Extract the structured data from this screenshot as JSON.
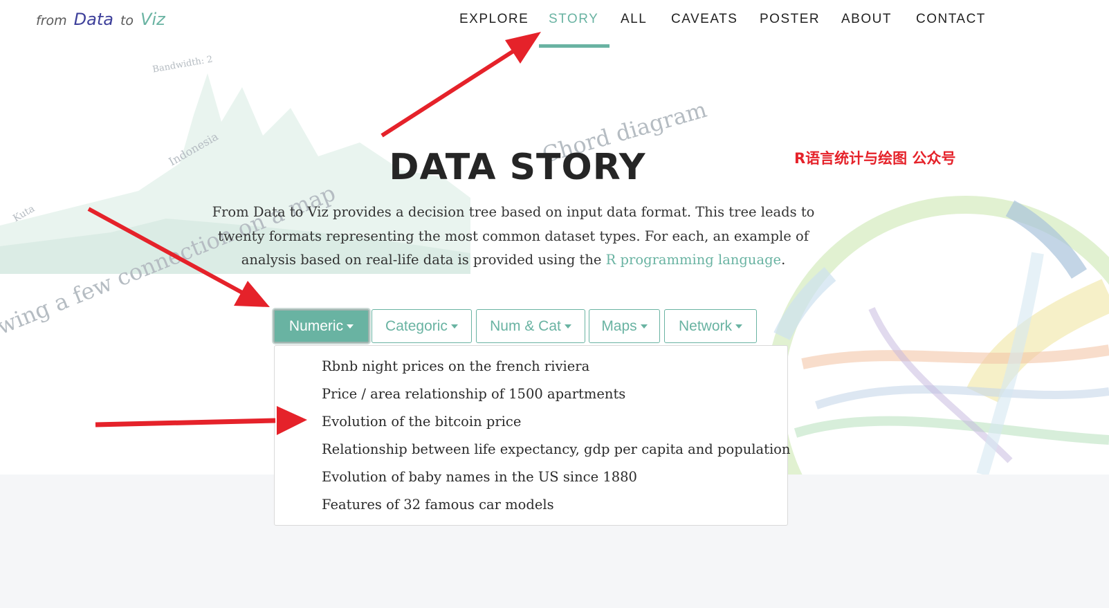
{
  "logo": {
    "part1": "from",
    "part2": "Data",
    "part3": "to",
    "part4": "Viz"
  },
  "nav": {
    "items": [
      "EXPLORE",
      "STORY",
      "ALL",
      "CAVEATS",
      "POSTER",
      "ABOUT",
      "CONTACT"
    ],
    "active": "STORY"
  },
  "hero": {
    "title": "DATA STORY",
    "intro_before_link": "From Data to Viz provides a decision tree based on input data format. This tree leads to twenty formats representing the most common dataset types. For each, an example of analysis based on real-life data is provided using the ",
    "intro_link": "R programming language",
    "intro_after_link": "."
  },
  "watermark": "R语言统计与绘图 公众号",
  "buttons": [
    "Numeric",
    "Categoric",
    "Num & Cat",
    "Maps",
    "Network"
  ],
  "active_button": "Numeric",
  "dropdown": {
    "items": [
      "Rbnb night prices on the french riviera",
      "Price / area relationship of 1500 apartments",
      "Evolution of the bitcoin price",
      "Relationship between life expectancy, gdp per capita and population",
      "Evolution of baby names in the US since 1880",
      "Features of 32 famous car models"
    ]
  },
  "background_text": {
    "chord": "Chord diagram",
    "connection": "wing a few connection on a map",
    "indonesia": "Indonesia",
    "bandwidth": "Bandwidth: 2",
    "kuta": "Kuta"
  },
  "colors": {
    "accent": "#69b3a2",
    "brand_blue": "#3d3f9a",
    "arrow_red": "#e5222a",
    "watermark_red": "#e5222a",
    "bottom_band": "#f5f6f8"
  }
}
